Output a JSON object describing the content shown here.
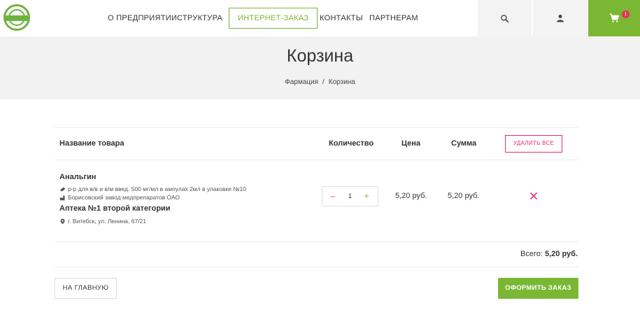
{
  "header": {
    "nav": [
      {
        "label": "О ПРЕДПРИЯТИИ"
      },
      {
        "label": "СТРУКТУРА"
      },
      {
        "label": "ИНТЕРНЕТ-ЗАКАЗ"
      },
      {
        "label": "КОНТАКТЫ"
      },
      {
        "label": "ПАРТНЕРАМ"
      }
    ],
    "icons": {
      "search": "search-icon",
      "account": "user-icon",
      "cart": "cart-icon"
    },
    "cart_count": "1"
  },
  "hero": {
    "title": "Корзина",
    "breadcrumb": {
      "home": "Фармация",
      "separator": "/",
      "current": "Корзина"
    }
  },
  "table": {
    "headers": {
      "name": "Название товара",
      "quantity": "Количество",
      "price": "Цена",
      "sum": "Сумма",
      "delete_all": "УДАЛИТЬ ВСЕ"
    },
    "rows": [
      {
        "name": "Анальгин",
        "form": "р-р для в/в и в/м введ. 500 мг/мл в ампулах 2мл в упаковке №10",
        "manufacturer": "Борисовский завод медпрепаратов ОАО",
        "pharmacy": "Аптека №1 второй категории",
        "address": "г. Витебск, ул. Ленина, 67/21",
        "minus": "–",
        "quantity": "1",
        "plus": "+",
        "price": "5,20 руб.",
        "sum": "5,20 руб."
      }
    ],
    "total_label": "Всего:",
    "total_value": "5,20 руб."
  },
  "actions": {
    "home": "НА ГЛАВНУЮ",
    "order": "ОФОРМИТЬ ЗАКАЗ"
  },
  "colors": {
    "accent": "#7ab834",
    "danger": "#e0306a"
  }
}
